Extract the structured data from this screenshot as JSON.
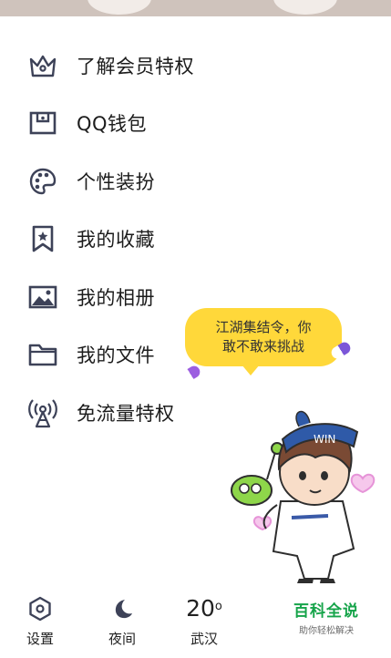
{
  "menu": {
    "items": [
      {
        "label": "了解会员特权",
        "icon": "crown-icon"
      },
      {
        "label": "QQ钱包",
        "icon": "wallet-icon"
      },
      {
        "label": "个性装扮",
        "icon": "palette-icon"
      },
      {
        "label": "我的收藏",
        "icon": "bookmark-star-icon"
      },
      {
        "label": "我的相册",
        "icon": "photo-icon"
      },
      {
        "label": "我的文件",
        "icon": "folder-icon"
      },
      {
        "label": "免流量特权",
        "icon": "antenna-icon"
      }
    ]
  },
  "promo": {
    "bubble_line1": "江湖集结令，你",
    "bubble_line2": "敢不敢来挑战"
  },
  "bottom_nav": {
    "settings_label": "设置",
    "night_label": "夜间",
    "weather_temp": "20",
    "weather_unit": "o",
    "weather_city": "武汉"
  },
  "watermark": {
    "title": "百科全说",
    "subtitle": "助你轻松解决"
  },
  "colors": {
    "icon": "#3d4258",
    "bubble": "#ffd83a",
    "watermark_green": "#16a44a"
  }
}
